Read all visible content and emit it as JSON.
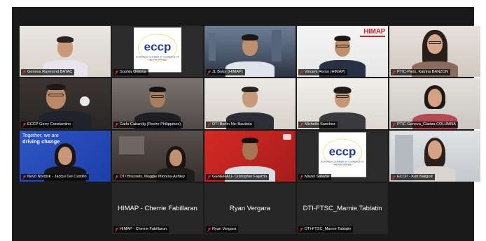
{
  "tiles": [
    {
      "id": "geneva",
      "label": "Geneva Raymond BATAC"
    },
    {
      "id": "sophia",
      "label": "Sophia Ordona"
    },
    {
      "id": "jlbotor",
      "label": "JL Botor (HIMAP)"
    },
    {
      "id": "vincent",
      "label": "Vincent Remo (HIMAP)"
    },
    {
      "id": "ptic-paris",
      "label": "PTIC-Paris, Katrina BANZON"
    },
    {
      "id": "gerry",
      "label": "ECCP Gerry Constantino"
    },
    {
      "id": "carlo",
      "label": "Carlo Cabanilg (Roche Philippines)"
    },
    {
      "id": "berlin",
      "label": "DTI Berlin-Nic Bautista"
    },
    {
      "id": "michelle",
      "label": "Michelle Sanchez"
    },
    {
      "id": "ptic-geneva",
      "label": "PTIC Geneva_Clariza COLUMNA"
    },
    {
      "id": "novo",
      "label": "Novo Nordisk - Jacqui Del Castillo"
    },
    {
      "id": "brussels",
      "label": "DTI Brussels, Maggie Mioolas-Ashley"
    },
    {
      "id": "generali",
      "label": "GENERALI- Cristopher Fajardo"
    },
    {
      "id": "mazel",
      "label": "Mazel Salazar"
    },
    {
      "id": "katt",
      "label": "ECCP - Katt Baligod"
    },
    {
      "id": "cherrie",
      "label": "HIMAP - Cherrie Fabillaran",
      "display": "HIMAP - Cherrie Fabillaran"
    },
    {
      "id": "ryan",
      "label": "Ryan Vergara",
      "display": "Ryan Vergara"
    },
    {
      "id": "marnie",
      "label": "DTI-FTSC_Marnie Tablatin",
      "display": "DTI-FTSC_Marnie Tablatin"
    }
  ],
  "logos": {
    "eccp": "eccp",
    "eccp_sub": "EUROPEAN CHAMBER OF COMMERCE OF THE PHILIPPINES",
    "himap": "HIMAP",
    "novo_line1": "Together,",
    "novo_line1b": "we are",
    "novo_line2": "driving change"
  },
  "colors": {
    "mic_muted": "#e53935",
    "active_border": "#c8d65b",
    "stage_bg": "#1a1a1a"
  },
  "icons": [
    "mic-muted-icon"
  ]
}
